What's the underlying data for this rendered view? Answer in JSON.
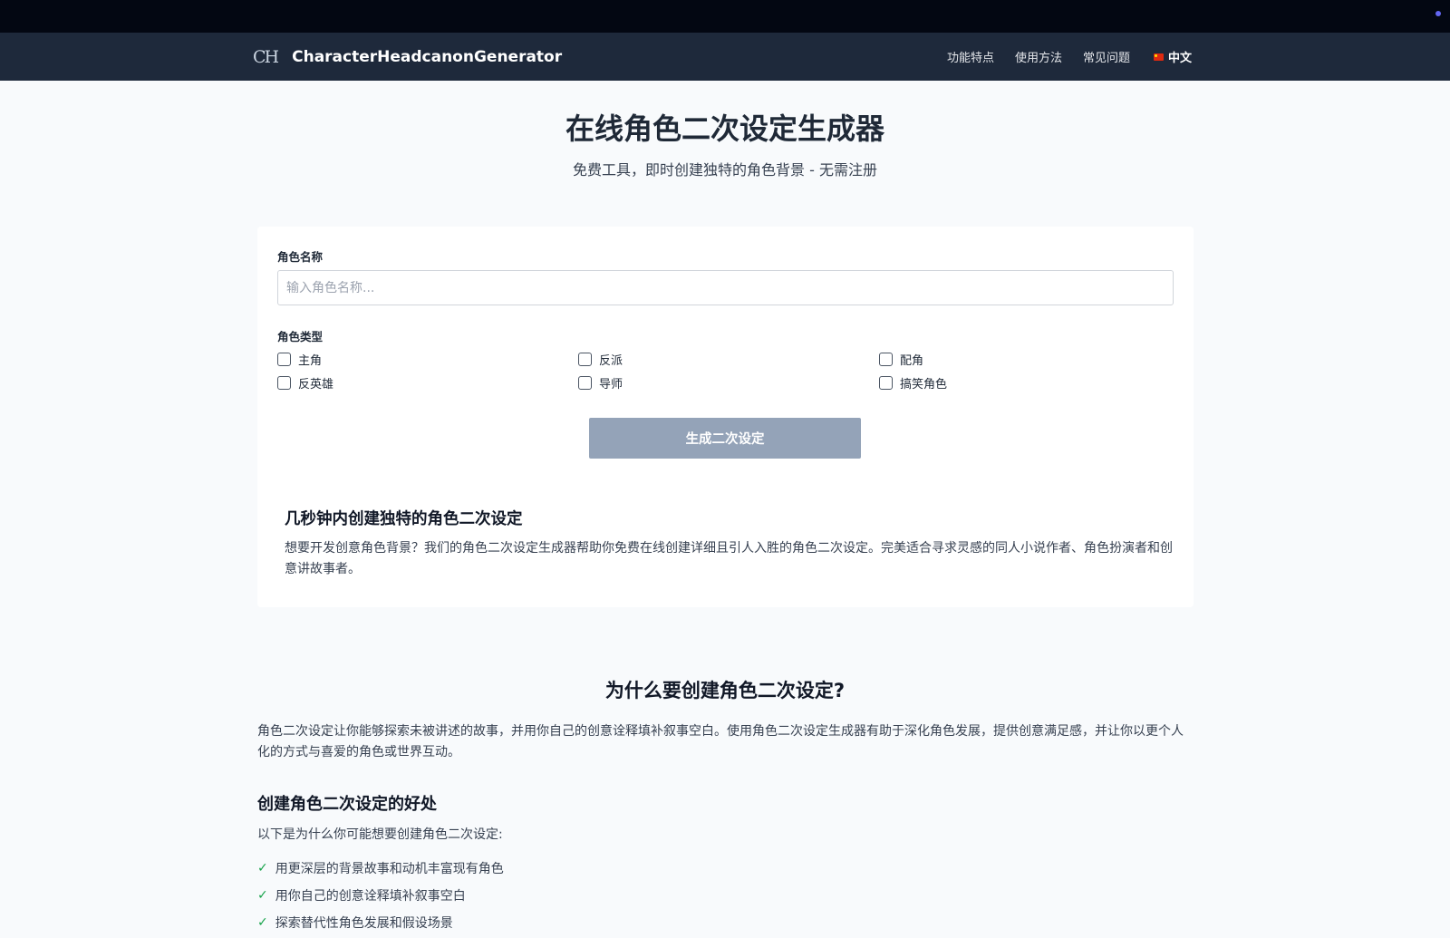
{
  "nav": {
    "logo": "CH",
    "brand": "CharacterHeadcanonGenerator",
    "links": [
      "功能特点",
      "使用方法",
      "常见问题"
    ],
    "language": "中文"
  },
  "hero": {
    "title": "在线角色二次设定生成器",
    "subtitle": "免费工具，即时创建独特的角色背景 - 无需注册"
  },
  "form": {
    "name_label": "角色名称",
    "name_placeholder": "输入角色名称...",
    "type_label": "角色类型",
    "types": [
      "主角",
      "反派",
      "配角",
      "反英雄",
      "导师",
      "搞笑角色"
    ],
    "button": "生成二次设定"
  },
  "intro": {
    "heading": "几秒钟内创建独特的角色二次设定",
    "text": "想要开发创意角色背景？我们的角色二次设定生成器帮助你免费在线创建详细且引人入胜的角色二次设定。完美适合寻求灵感的同人小说作者、角色扮演者和创意讲故事者。"
  },
  "why": {
    "heading": "为什么要创建角色二次设定?",
    "text": "角色二次设定让你能够探索未被讲述的故事，并用你自己的创意诠释填补叙事空白。使用角色二次设定生成器有助于深化角色发展，提供创意满足感，并让你以更个人化的方式与喜爱的角色或世界互动。"
  },
  "benefits": {
    "heading": "创建角色二次设定的好处",
    "intro": "以下是为什么你可能想要创建角色二次设定:",
    "items": [
      "用更深层的背景故事和动机丰富现有角色",
      "用你自己的创意诠释填补叙事空白",
      "探索替代性角色发展和假设场景"
    ]
  }
}
